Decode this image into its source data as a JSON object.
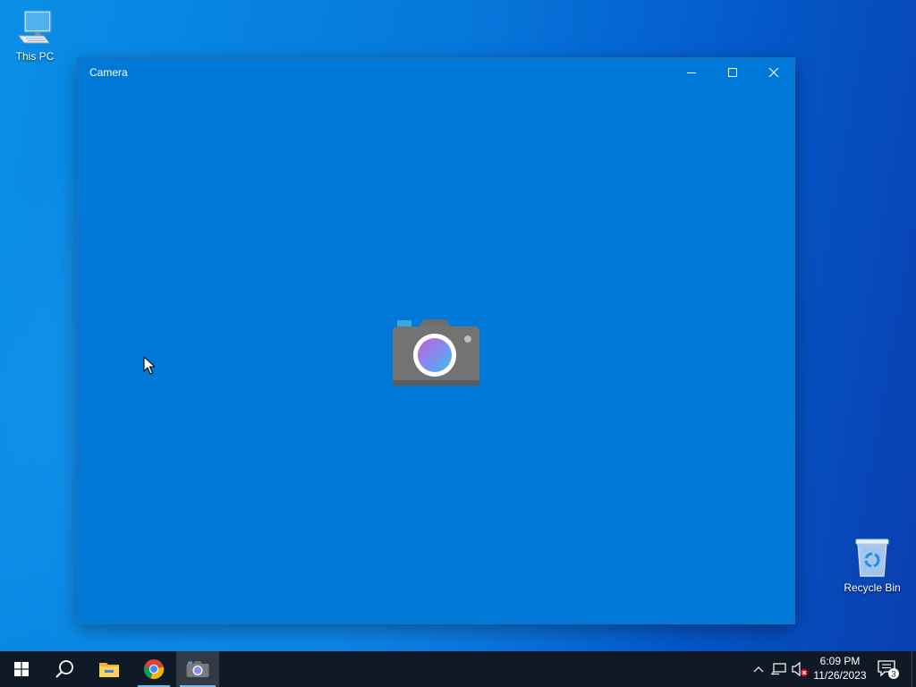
{
  "desktop": {
    "icons": [
      {
        "label": "This PC",
        "icon": "computer-icon"
      },
      {
        "label": "Recycle Bin",
        "icon": "recycle-bin-icon"
      }
    ],
    "colors": {
      "background_main": "#0678dc",
      "background_edge": "#0a3fb0"
    }
  },
  "window": {
    "title": "Camera",
    "background": "#0078d7",
    "controls": {
      "minimize": "minimize-icon",
      "maximize": "maximize-icon",
      "close": "close-icon"
    },
    "splash_icon": "camera-app-icon"
  },
  "taskbar": {
    "background": "#101a27",
    "items": [
      {
        "name": "start",
        "icon": "windows-logo-icon"
      },
      {
        "name": "search",
        "icon": "search-icon"
      },
      {
        "name": "file-explorer",
        "icon": "folder-icon"
      },
      {
        "name": "chrome",
        "icon": "chrome-icon",
        "running": true
      },
      {
        "name": "camera",
        "icon": "camera-icon",
        "running": true,
        "active": true
      }
    ],
    "tray": {
      "icons": [
        "chevron-up-icon",
        "network-icon",
        "volume-muted-icon"
      ],
      "time": "6:09 PM",
      "date": "11/26/2023",
      "notification_count": "3"
    }
  }
}
